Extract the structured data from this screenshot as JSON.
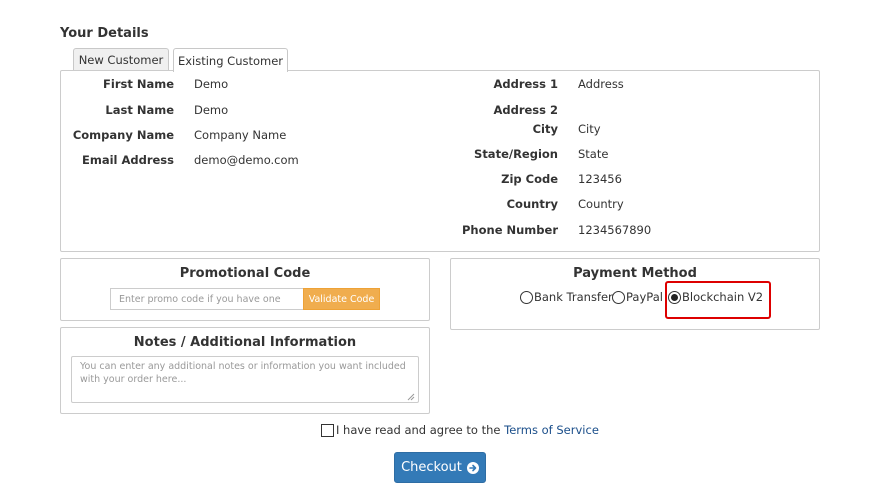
{
  "section_title": "Your Details",
  "tabs": [
    {
      "label": "New Customer",
      "active": false
    },
    {
      "label": "Existing Customer",
      "active": true
    }
  ],
  "details": {
    "left": [
      {
        "label": "First Name",
        "value": "Demo"
      },
      {
        "label": "Last Name",
        "value": "Demo"
      },
      {
        "label": "Company Name",
        "value": "Company Name"
      },
      {
        "label": "Email Address",
        "value": "demo@demo.com"
      }
    ],
    "right": [
      {
        "label": "Address 1",
        "value": "Address"
      },
      {
        "label": "Address 2",
        "value": ""
      },
      {
        "label": "City",
        "value": "City"
      },
      {
        "label": "State/Region",
        "value": "State"
      },
      {
        "label": "Zip Code",
        "value": "123456"
      },
      {
        "label": "Country",
        "value": "Country"
      },
      {
        "label": "Phone Number",
        "value": "1234567890"
      }
    ]
  },
  "promo": {
    "title": "Promotional Code",
    "placeholder": "Enter promo code if you have one",
    "button": "Validate Code"
  },
  "payment": {
    "title": "Payment Method",
    "options": [
      {
        "label": "Bank Transfer",
        "checked": false
      },
      {
        "label": "PayPal",
        "checked": false
      },
      {
        "label": "Blockchain V2",
        "checked": true
      }
    ]
  },
  "notes": {
    "title": "Notes / Additional Information",
    "placeholder": "You can enter any additional notes or information you want included with your order here..."
  },
  "tos": {
    "text": "I have read and agree to the",
    "link": "Terms of Service"
  },
  "checkout": {
    "label": "Checkout"
  },
  "colors": {
    "highlight": "#dd0000",
    "checkout": "#337ab7",
    "validate": "#f0ad4e",
    "link": "#1a4e8a"
  }
}
